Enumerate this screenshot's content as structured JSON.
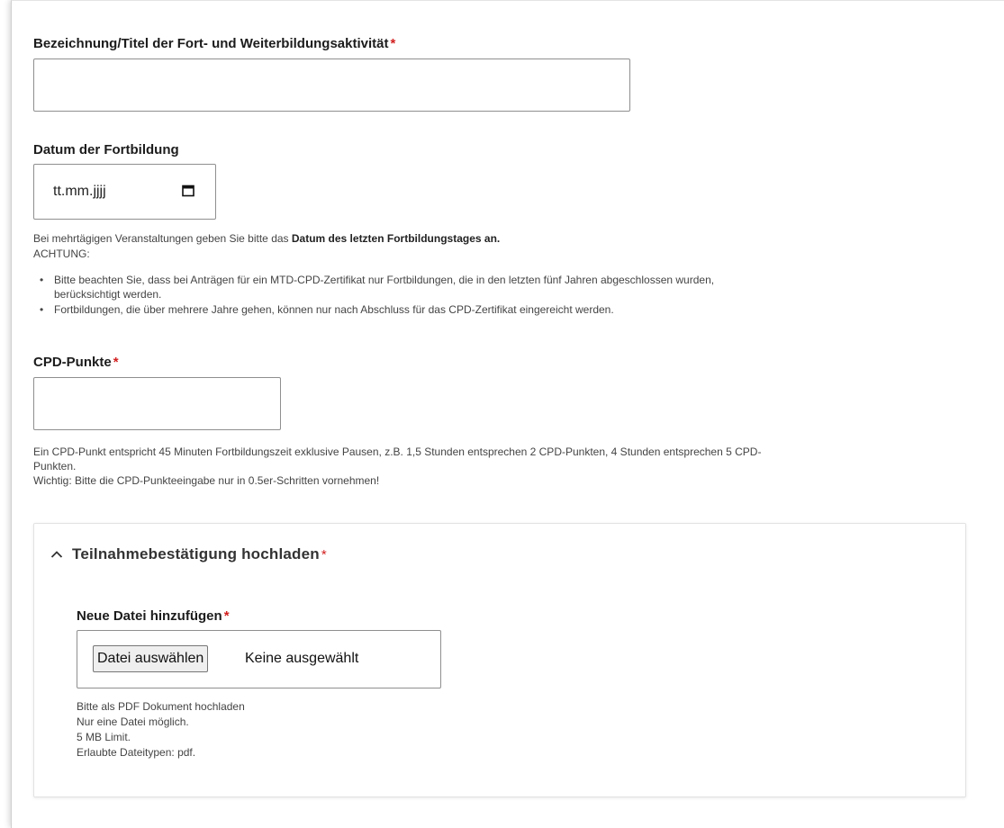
{
  "title_field": {
    "label": "Bezeichnung/Titel der Fort- und Weiterbildungsaktivität",
    "required_mark": "*",
    "value": ""
  },
  "date_field": {
    "label": "Datum der Fortbildung",
    "placeholder": "tt.mm.jjjj",
    "icon": "calendar-icon",
    "help_prefix": "Bei mehrtägigen Veranstaltungen geben Sie bitte das ",
    "help_bold": "Datum des letzten Fortbildungstages an.",
    "attention": "ACHTUNG:",
    "bullets": [
      {
        "line1": "Bitte beachten Sie, dass bei Anträgen für ein MTD-CPD-Zertifikat nur Fortbildungen, die in den letzten fünf Jahren abgeschlossen wurden,",
        "line2": "berücksichtigt werden."
      },
      {
        "line1": "Fortbildungen, die über mehrere Jahre gehen, können nur nach Abschluss für das CPD-Zertifikat eingereicht werden.",
        "line2": ""
      }
    ]
  },
  "cpd_field": {
    "label": "CPD-Punkte",
    "required_mark": "*",
    "value": "",
    "help_line1": "Ein CPD-Punkt entspricht 45 Minuten Fortbildungszeit exklusive Pausen, z.B. 1,5 Stunden entsprechen 2 CPD-Punkten, 4 Stunden entsprechen 5 CPD-",
    "help_line2": "Punkten.",
    "help_line3": "Wichtig: Bitte die CPD-Punkteeingabe nur in 0.5er-Schritten vornehmen!"
  },
  "upload_panel": {
    "title": "Teilnahmebestätigung hochladen",
    "required_mark": "*",
    "chevron_icon": "chevron-up-icon",
    "file_label": "Neue Datei hinzufügen",
    "file_button": "Datei auswählen",
    "file_status": "Keine ausgewählt",
    "help": [
      "Bitte als PDF Dokument hochladen",
      "Nur eine Datei möglich.",
      "5 MB Limit.",
      "Erlaubte Dateitypen: pdf."
    ]
  },
  "colors": {
    "required": "#d21f1f",
    "border": "#8f8f8f"
  }
}
